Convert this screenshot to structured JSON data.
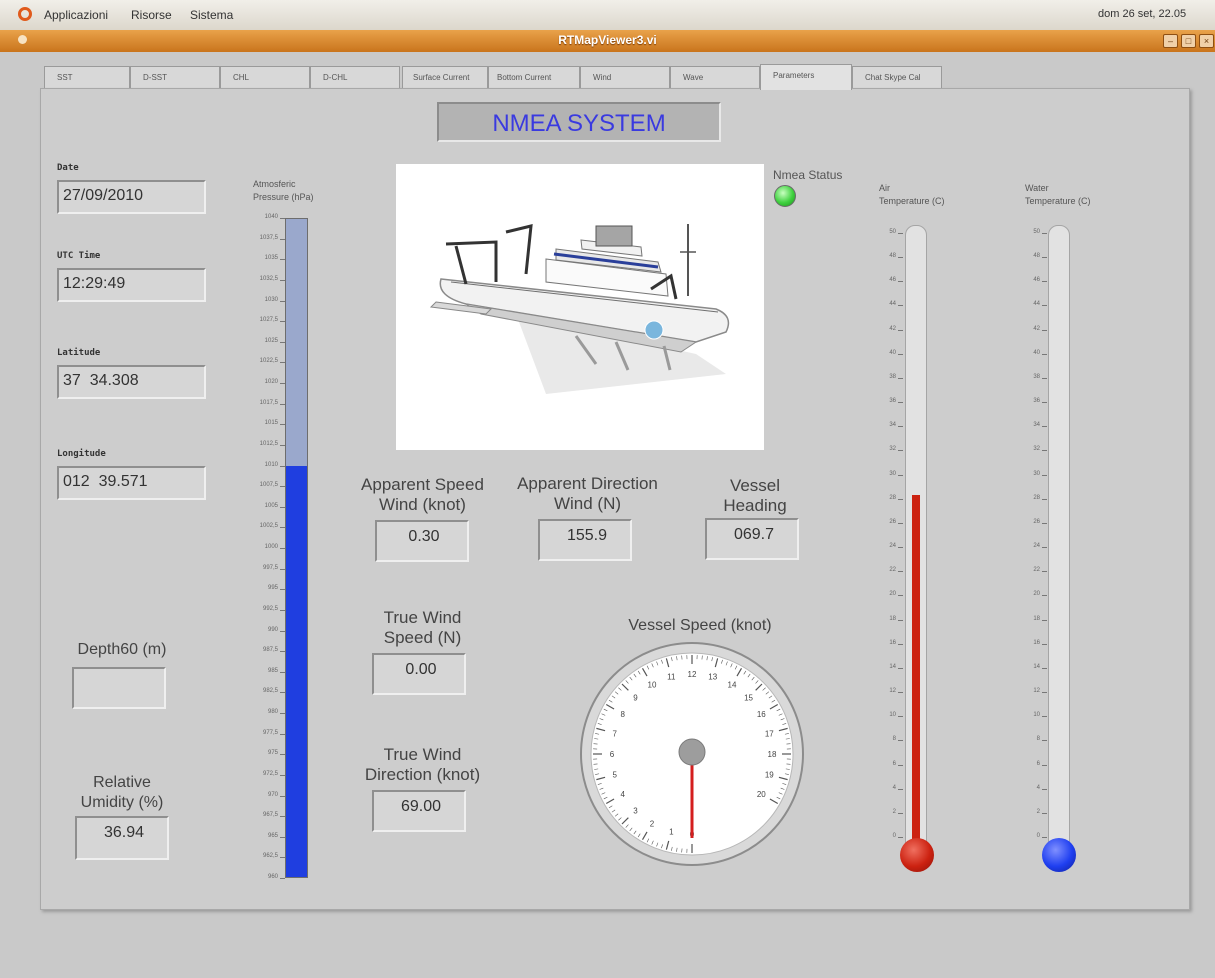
{
  "system_bar": {
    "menus": [
      "Applicazioni",
      "Risorse",
      "Sistema"
    ],
    "clock": "dom 26 set, 22.05"
  },
  "window": {
    "title": "RTMapViewer3.vi"
  },
  "tabs": [
    "SST",
    "D-SST",
    "CHL",
    "D-CHL",
    "Surface Current",
    "Bottom Current",
    "Wind",
    "Wave",
    "Parameters",
    "Chat Skype Cal"
  ],
  "active_tab": "Parameters",
  "panel": {
    "title": "NMEA SYSTEM",
    "date": {
      "label": "Date",
      "value": "27/09/2010"
    },
    "utc_time": {
      "label": "UTC Time",
      "value": "12:29:49"
    },
    "latitude": {
      "label": "Latitude",
      "value": "37  34.308"
    },
    "longitude": {
      "label": "Longitude",
      "value": "012  39.571"
    },
    "depth": {
      "label": "Depth60 (m)",
      "value": ""
    },
    "humidity": {
      "label_line1": "Relative",
      "label_line2": "Umidity (%)",
      "value": "36.94"
    },
    "pressure": {
      "label_line1": "Atmosferic",
      "label_line2": "Pressure (hPa)",
      "min": 960,
      "max": 1040,
      "value": 1010,
      "ticks": [
        "1040",
        "1037,5",
        "1035",
        "1032,5",
        "1030",
        "1027,5",
        "1025",
        "1022,5",
        "1020",
        "1017,5",
        "1015",
        "1012,5",
        "1010",
        "1007,5",
        "1005",
        "1002,5",
        "1000",
        "997,5",
        "995",
        "992,5",
        "990",
        "987,5",
        "985",
        "982,5",
        "980",
        "977,5",
        "975",
        "972,5",
        "970",
        "967,5",
        "965",
        "962,5",
        "960"
      ]
    },
    "nmea_status": {
      "label": "Nmea Status",
      "color": "#3fd13f"
    },
    "apparent_speed": {
      "line1": "Apparent Speed",
      "line2": "Wind (knot)",
      "value": "0.30"
    },
    "apparent_direction": {
      "line1": "Apparent Direction",
      "line2": "Wind (N)",
      "value": "155.9"
    },
    "vessel_heading": {
      "line1": "Vessel",
      "line2": "Heading",
      "value": "069.7"
    },
    "true_wind_speed": {
      "line1": "True Wind",
      "line2": "Speed (N)",
      "value": "0.00"
    },
    "true_wind_direction": {
      "line1": "True Wind",
      "line2": "Direction (knot)",
      "value": "69.00"
    },
    "vessel_speed": {
      "label": "Vessel Speed (knot)",
      "value": 0,
      "dial_numbers": [
        "0",
        "1",
        "2",
        "3",
        "4",
        "5",
        "6",
        "7",
        "8",
        "9",
        "10",
        "11",
        "12",
        "13",
        "14",
        "15",
        "16",
        "17",
        "18",
        "19",
        "20"
      ]
    },
    "air_temperature": {
      "label_line1": "Air",
      "label_line2": "Temperature (C)",
      "min": 0,
      "max": 50,
      "value": 29,
      "color": "#cc2211"
    },
    "water_temperature": {
      "label_line1": "Water",
      "label_line2": "Temperature (C)",
      "min": 0,
      "max": 50,
      "value": 0,
      "color": "#1f3ff0"
    },
    "temp_ticks": [
      "50",
      "48",
      "46",
      "44",
      "42",
      "40",
      "38",
      "36",
      "34",
      "32",
      "30",
      "28",
      "26",
      "24",
      "22",
      "20",
      "18",
      "16",
      "14",
      "12",
      "10",
      "8",
      "6",
      "4",
      "2",
      "0"
    ],
    "ship_image": "research-vessel-icon"
  },
  "colors": {
    "pressure_fill": "#1f3ee0",
    "pressure_empty": "#9aa8cc",
    "title_text": "#3a3ae0"
  }
}
